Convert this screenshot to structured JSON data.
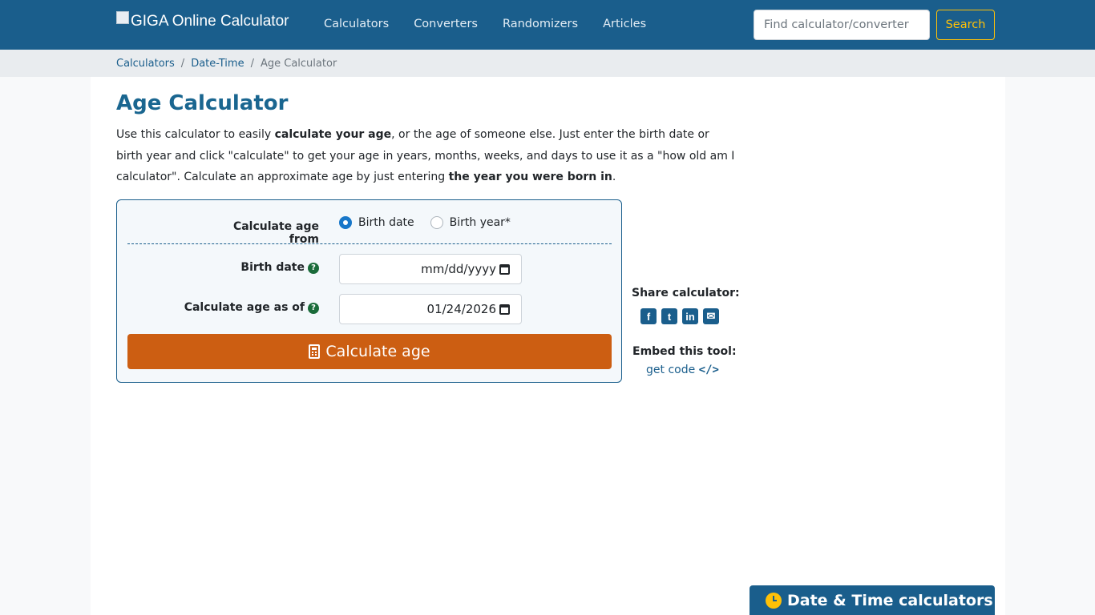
{
  "navbar": {
    "brand": "GIGA Online Calculator",
    "links": [
      "Calculators",
      "Converters",
      "Randomizers",
      "Articles"
    ],
    "search_placeholder": "Find calculator/converter",
    "search_button": "Search"
  },
  "breadcrumb": {
    "items": [
      "Calculators",
      "Date-Time"
    ],
    "current": "Age Calculator"
  },
  "page": {
    "title": "Age Calculator",
    "intro_1": "Use this calculator to easily ",
    "intro_bold_1": "calculate your age",
    "intro_2": ", or the age of someone else. Just enter the birth date or birth year and click \"calculate\" to get your age in years, months, weeks, and days to use it as a \"how old am I calculator\". Calculate an approximate age by just entering ",
    "intro_bold_2": "the year you were born in",
    "intro_3": "."
  },
  "calculator": {
    "calc_from_label": "Calculate age from",
    "radio_birth_date": "Birth date",
    "radio_birth_year": "Birth year*",
    "birth_date_label": "Birth date",
    "birth_date_value": "mm/dd/yyyy",
    "calc_as_of_label": "Calculate age as of",
    "calc_as_of_value": "01/24/2026",
    "help_glyph": "?",
    "button_label": "Calculate age"
  },
  "share": {
    "title": "Share calculator:",
    "icons": [
      "facebook-icon",
      "twitter-icon",
      "linkedin-icon",
      "email-icon"
    ],
    "embed_title": "Embed this tool:",
    "embed_link": "get code",
    "embed_code_glyph": "</>"
  },
  "side_panel": {
    "title": "Date & Time calculators"
  },
  "colors": {
    "navbar": "#1a5e8c",
    "accent_yellow": "#ffc107",
    "button_orange": "#cc5e12",
    "title_blue": "#1a6690"
  }
}
